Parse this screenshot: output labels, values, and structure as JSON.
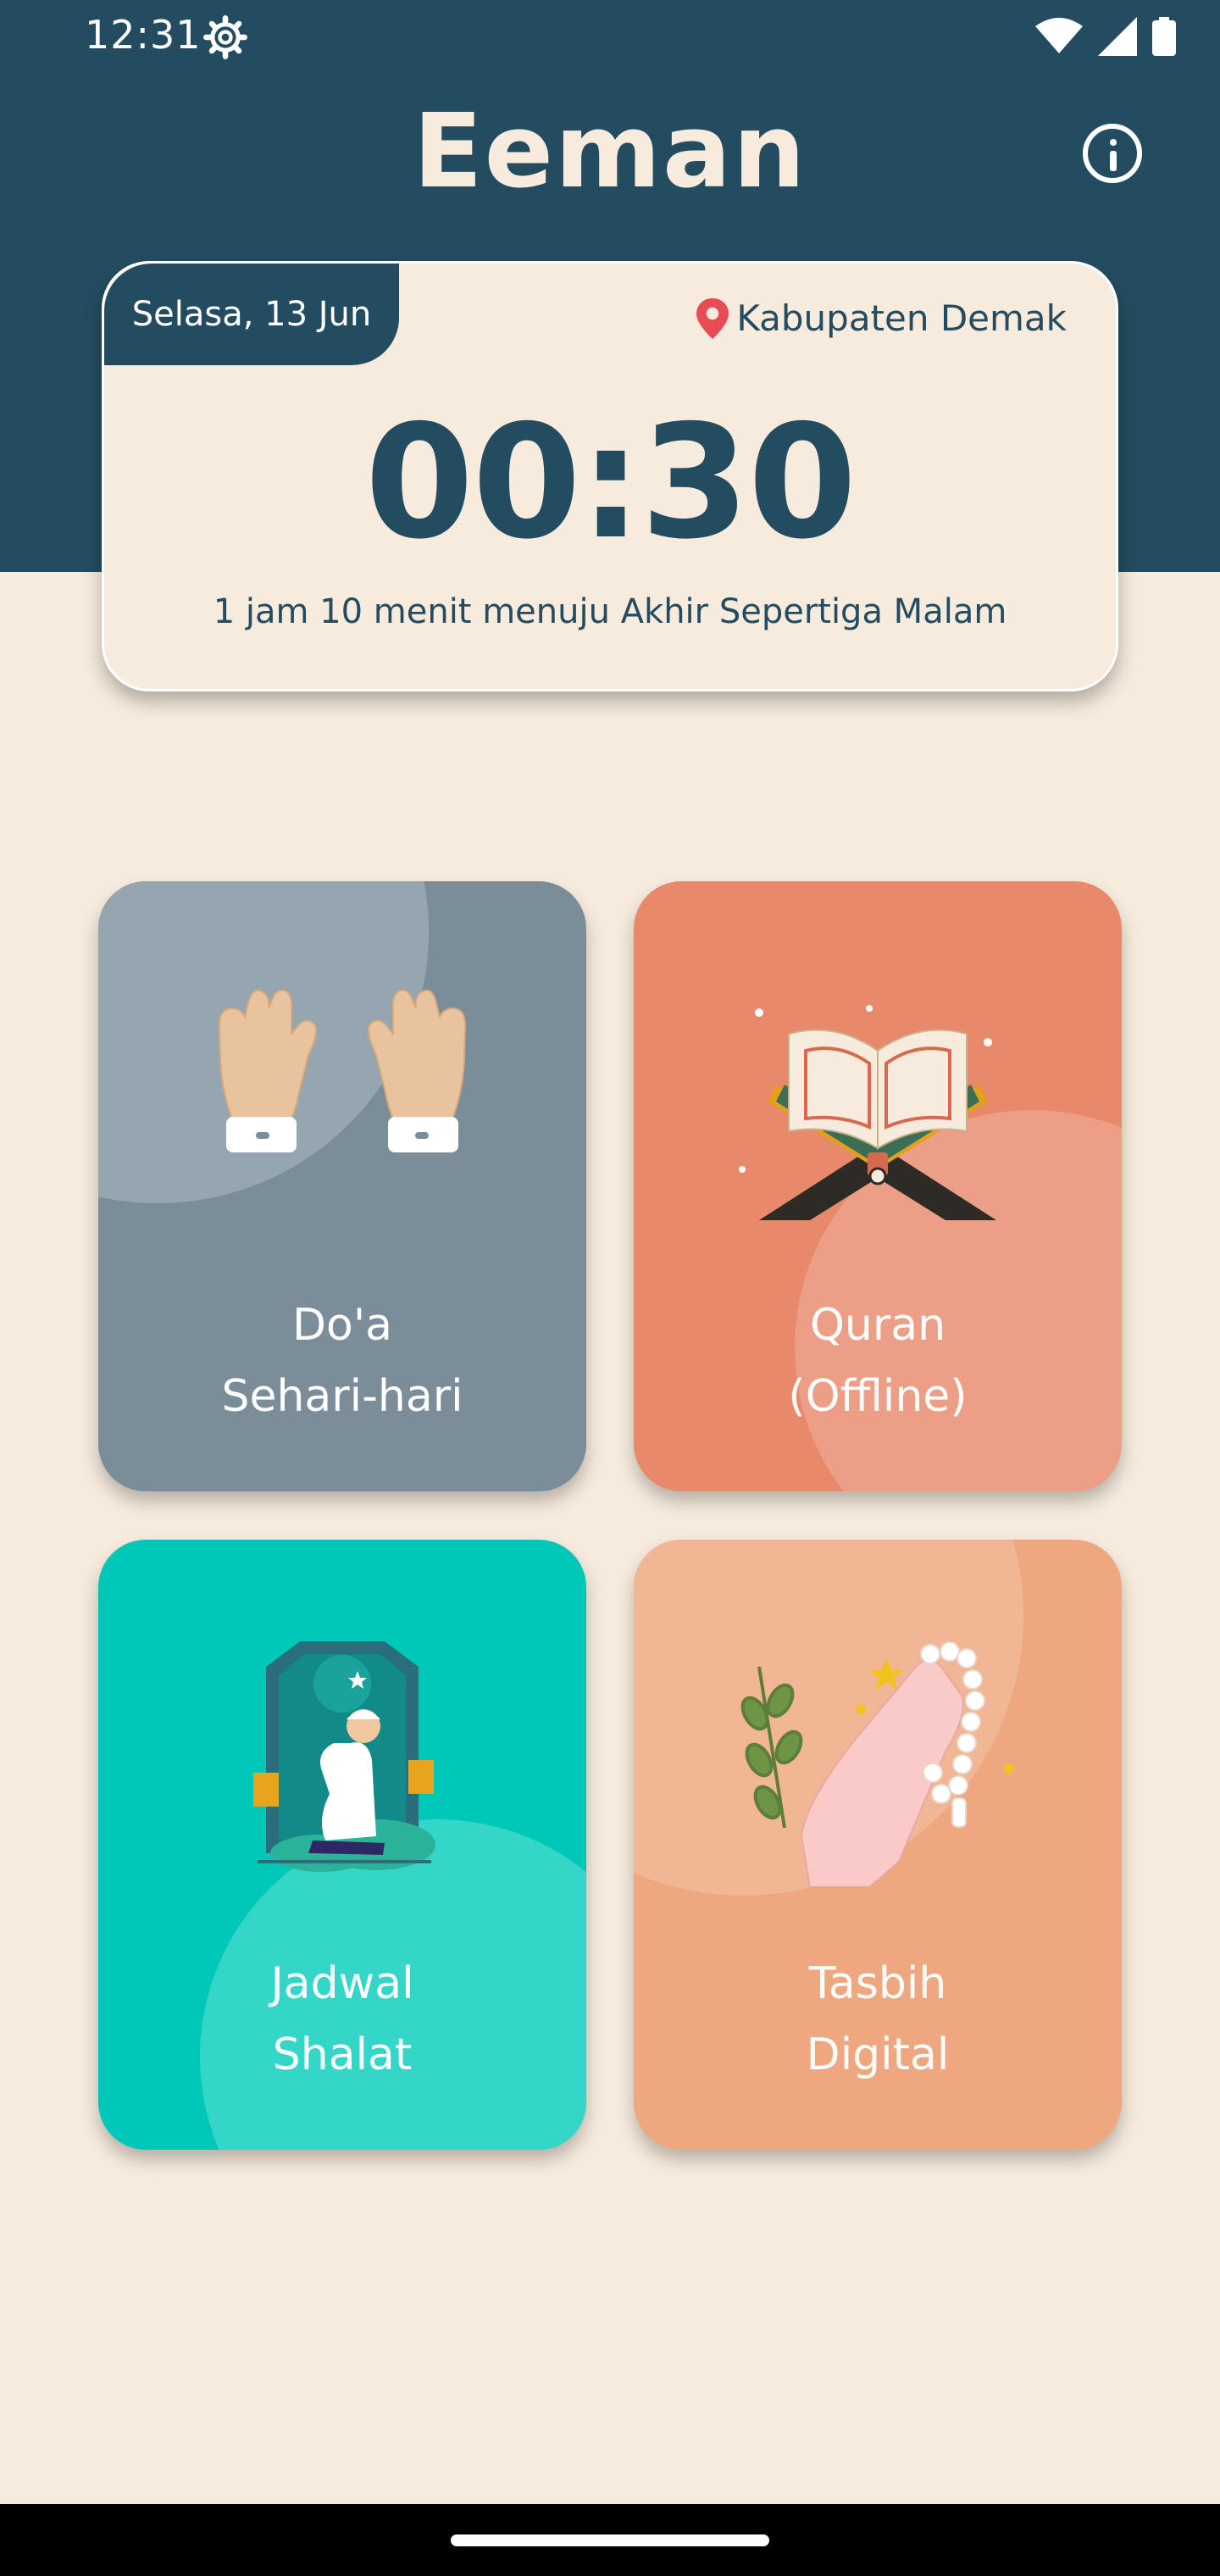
{
  "status_bar": {
    "time": "12:31"
  },
  "header": {
    "title": "Eeman"
  },
  "time_card": {
    "date": "Selasa, 13 Jun",
    "location": "Kabupaten Demak",
    "time": "00:30",
    "countdown": "1 jam 10 menit menuju Akhir Sepertiga Malam"
  },
  "menu": [
    {
      "line1": "Do'a",
      "line2": "Sehari-hari",
      "color": "#7A8D99"
    },
    {
      "line1": "Quran",
      "line2": "(Offline)",
      "color": "#E9896C"
    },
    {
      "line1": "Jadwal",
      "line2": "Shalat",
      "color": "#00C8B8"
    },
    {
      "line1": "Tasbih",
      "line2": "Digital",
      "color": "#EEA77F"
    }
  ],
  "icons": [
    "settings-icon",
    "wifi-icon",
    "signal-icon",
    "battery-icon",
    "info-icon",
    "location-pin-icon",
    "praying-hands-icon",
    "quran-icon",
    "prayer-schedule-icon",
    "tasbih-icon"
  ]
}
